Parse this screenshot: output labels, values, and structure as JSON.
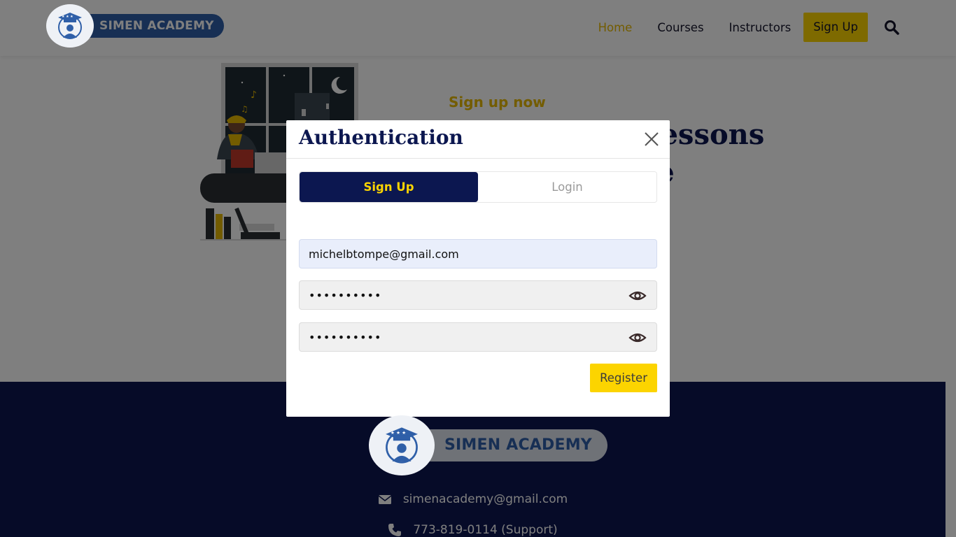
{
  "header": {
    "logo_text": "SIMEN ACADEMY",
    "nav": [
      "Home",
      "Courses",
      "Instructors"
    ],
    "signup_label": "Sign Up"
  },
  "hero": {
    "eyebrow": "Sign up now",
    "title": "Get the best lessons online for free"
  },
  "footer": {
    "logo_text": "SIMEN ACADEMY",
    "email": "simenacademy@gmail.com",
    "phone": "773-819-0114 (Support)"
  },
  "modal": {
    "title": "Authentication",
    "tabs": [
      "Sign Up",
      "Login"
    ],
    "email_value": "michelbtompe@gmail.com",
    "password_value": "••••••••••",
    "confirm_value": "••••••••••",
    "register_label": "Register"
  },
  "colors": {
    "navy": "#0c1750",
    "yellow": "#fcd400",
    "active_nav": "#e6b800"
  }
}
